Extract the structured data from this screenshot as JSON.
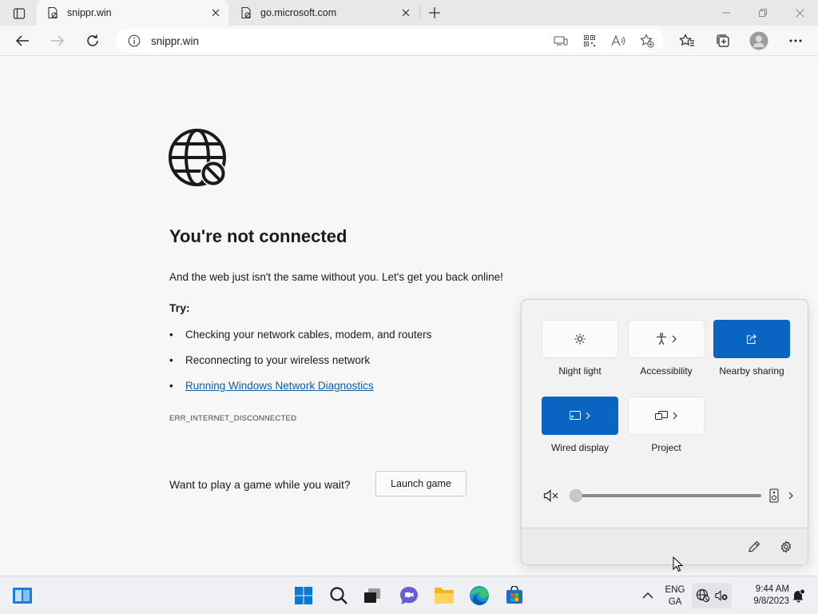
{
  "browser": {
    "tabs": [
      {
        "title": "snippr.win",
        "active": true
      },
      {
        "title": "go.microsoft.com",
        "active": false
      }
    ],
    "address": "snippr.win"
  },
  "page": {
    "heading": "You're not connected",
    "lead": "And the web just isn't the same without you. Let's get you back online!",
    "try_label": "Try:",
    "try_items": [
      "Checking your network cables, modem, and routers",
      "Reconnecting to your wireless network",
      "Running Windows Network Diagnostics"
    ],
    "bullet": "•",
    "error_code": "ERR_INTERNET_DISCONNECTED",
    "game_prompt": "Want to play a game while you wait?",
    "game_button": "Launch game"
  },
  "quick_settings": {
    "tiles": [
      {
        "label": "Night light",
        "icon": "brightness-icon",
        "on": false
      },
      {
        "label": "Accessibility",
        "icon": "accessibility-icon",
        "on": false
      },
      {
        "label": "Nearby sharing",
        "icon": "share-icon",
        "on": true
      },
      {
        "label": "Wired display",
        "icon": "cast-icon",
        "on": true
      },
      {
        "label": "Project",
        "icon": "project-icon",
        "on": false
      }
    ],
    "volume": 0,
    "accent": "#0a64c2"
  },
  "taskbar": {
    "lang_line1": "ENG",
    "lang_line2": "GA",
    "time": "9:44 AM",
    "date": "9/8/2023"
  }
}
